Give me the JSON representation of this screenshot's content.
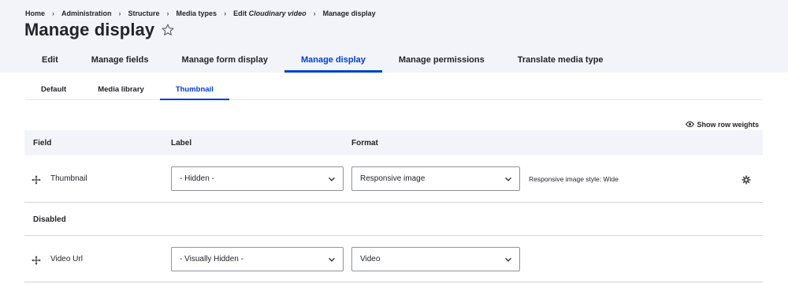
{
  "breadcrumb": [
    {
      "text": "Home"
    },
    {
      "text": "Administration"
    },
    {
      "text": "Structure"
    },
    {
      "text": "Media types"
    },
    {
      "prefix": "Edit ",
      "italic": "Cloudinary video"
    },
    {
      "text": "Manage display"
    }
  ],
  "page": {
    "title": "Manage display",
    "star_icon": "star-outline-icon"
  },
  "primary_tabs": [
    {
      "label": "Edit",
      "active": false
    },
    {
      "label": "Manage fields",
      "active": false
    },
    {
      "label": "Manage form display",
      "active": false
    },
    {
      "label": "Manage display",
      "active": true
    },
    {
      "label": "Manage permissions",
      "active": false
    },
    {
      "label": "Translate media type",
      "active": false
    }
  ],
  "secondary_tabs": [
    {
      "label": "Default",
      "active": false
    },
    {
      "label": "Media library",
      "active": false
    },
    {
      "label": "Thumbnail",
      "active": true
    }
  ],
  "row_weights": {
    "label": "Show row weights",
    "icon": "eye-icon"
  },
  "table": {
    "headers": {
      "field": "Field",
      "label": "Label",
      "format": "Format"
    },
    "rows": [
      {
        "field": "Thumbnail",
        "label_value": "- Hidden -",
        "format_value": "Responsive image",
        "summary": "Responsive image style: Wide",
        "settings_icon": "gear-icon"
      }
    ],
    "disabled_region": "Disabled",
    "disabled_rows": [
      {
        "field": "Video Url",
        "label_value": "- Visually Hidden -",
        "format_value": "Video"
      }
    ]
  },
  "colors": {
    "accent": "#003ecc",
    "header_bg": "#f3f4f9",
    "text": "#232429",
    "border": "#8e929c"
  }
}
